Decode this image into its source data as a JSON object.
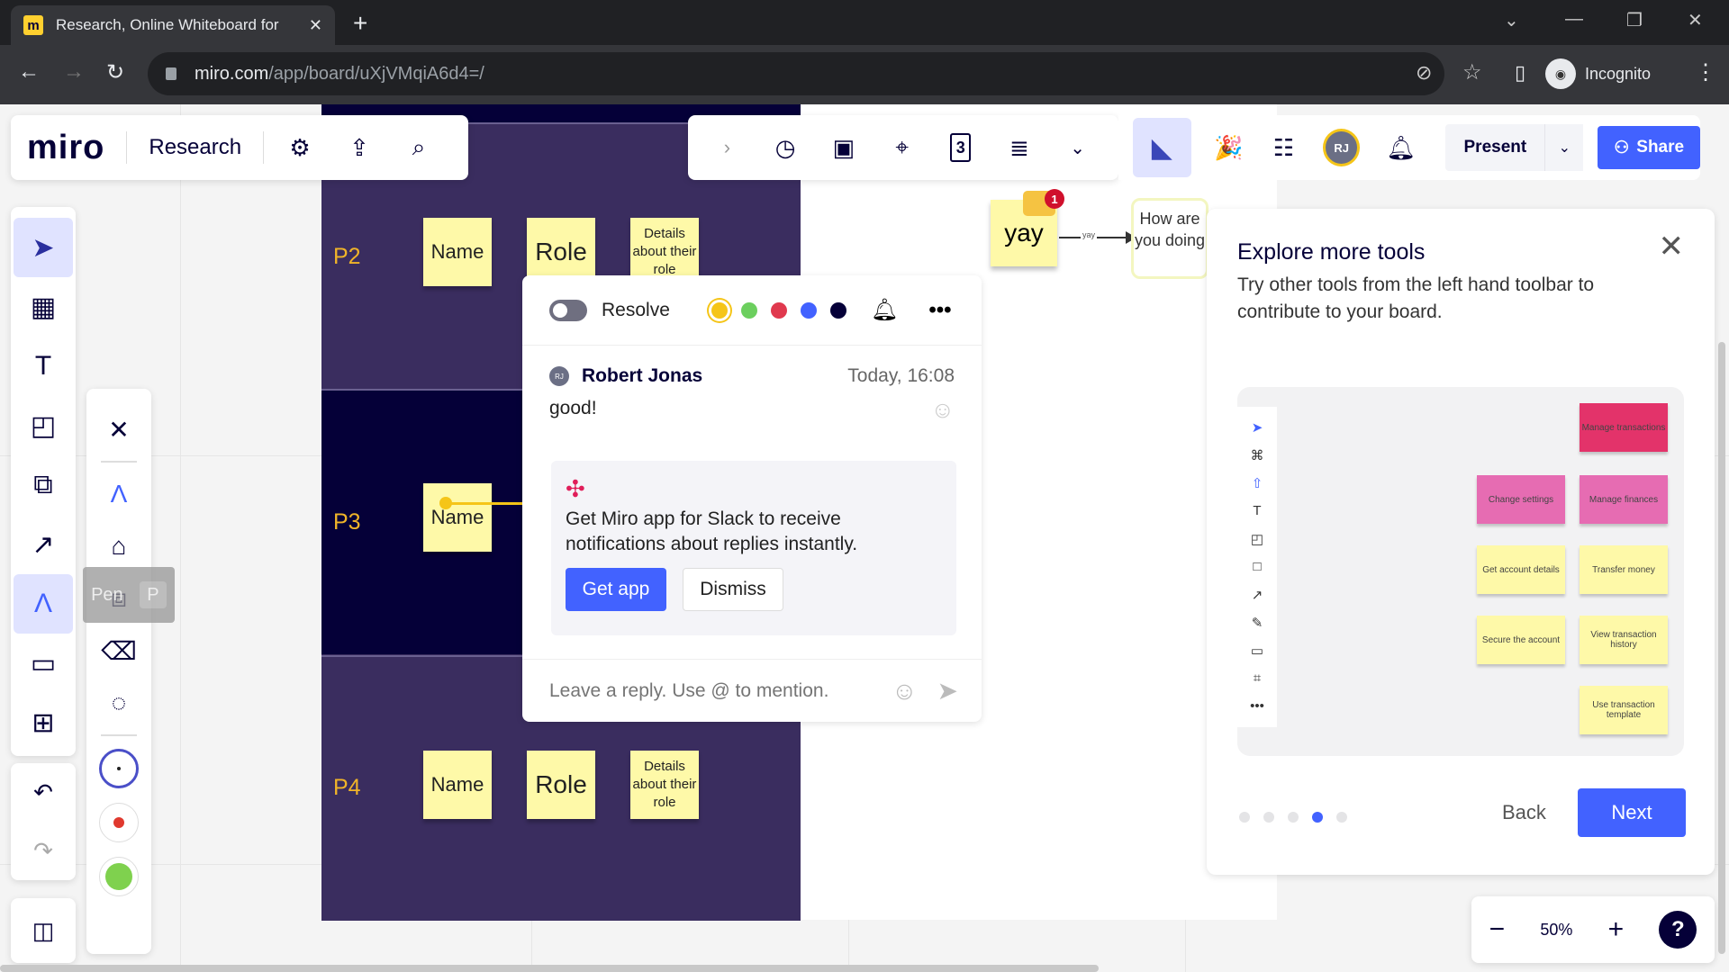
{
  "browser": {
    "tab_title": "Research, Online Whiteboard for",
    "url_host": "miro.com",
    "url_path": "/app/board/uXjVMqiA6d4=/",
    "profile_label": "Incognito"
  },
  "header": {
    "logo": "miro",
    "board_name": "Research",
    "avatar_initials": "RJ",
    "present_label": "Present",
    "share_label": "Share",
    "timer_icon": "timer-icon",
    "count_badge": "3"
  },
  "board": {
    "rows": [
      {
        "label": "P2",
        "stickies": [
          "Name",
          "Role",
          "Details about their role"
        ]
      },
      {
        "label": "P3",
        "stickies": [
          "Name"
        ]
      },
      {
        "label": "P4",
        "stickies": [
          "Name",
          "Role",
          "Details about their role"
        ]
      }
    ],
    "yay_sticky": "yay",
    "yay_comment_count": "1",
    "connector_label": "yay",
    "how_card": "How are you doing"
  },
  "comment": {
    "resolve_label": "Resolve",
    "colors": [
      "#f5c518",
      "#6ccf5e",
      "#e0394e",
      "#4262ff",
      "#050038"
    ],
    "author_initials": "RJ",
    "author": "Robert Jonas",
    "time": "Today, 16:08",
    "text": "good!",
    "slack_text": "Get Miro app for Slack to receive notifications about replies instantly.",
    "get_app_label": "Get app",
    "dismiss_label": "Dismiss",
    "reply_placeholder": "Leave a reply. Use @ to mention."
  },
  "tooltip": {
    "label": "Pen",
    "shortcut": "P"
  },
  "explore": {
    "title": "Explore more tools",
    "description": "Try other tools from the left hand toolbar to contribute to your board.",
    "preview_stickies": {
      "pink": [
        "Manage transactions",
        "Change settings",
        "Manage finances"
      ],
      "yellow": [
        "Get account details",
        "Transfer money",
        "Secure the account",
        "View transaction history",
        "Use transaction template"
      ]
    },
    "step_current": 4,
    "step_total": 5,
    "back_label": "Back",
    "next_label": "Next"
  },
  "zoom": {
    "value": "50%",
    "help": "?"
  }
}
